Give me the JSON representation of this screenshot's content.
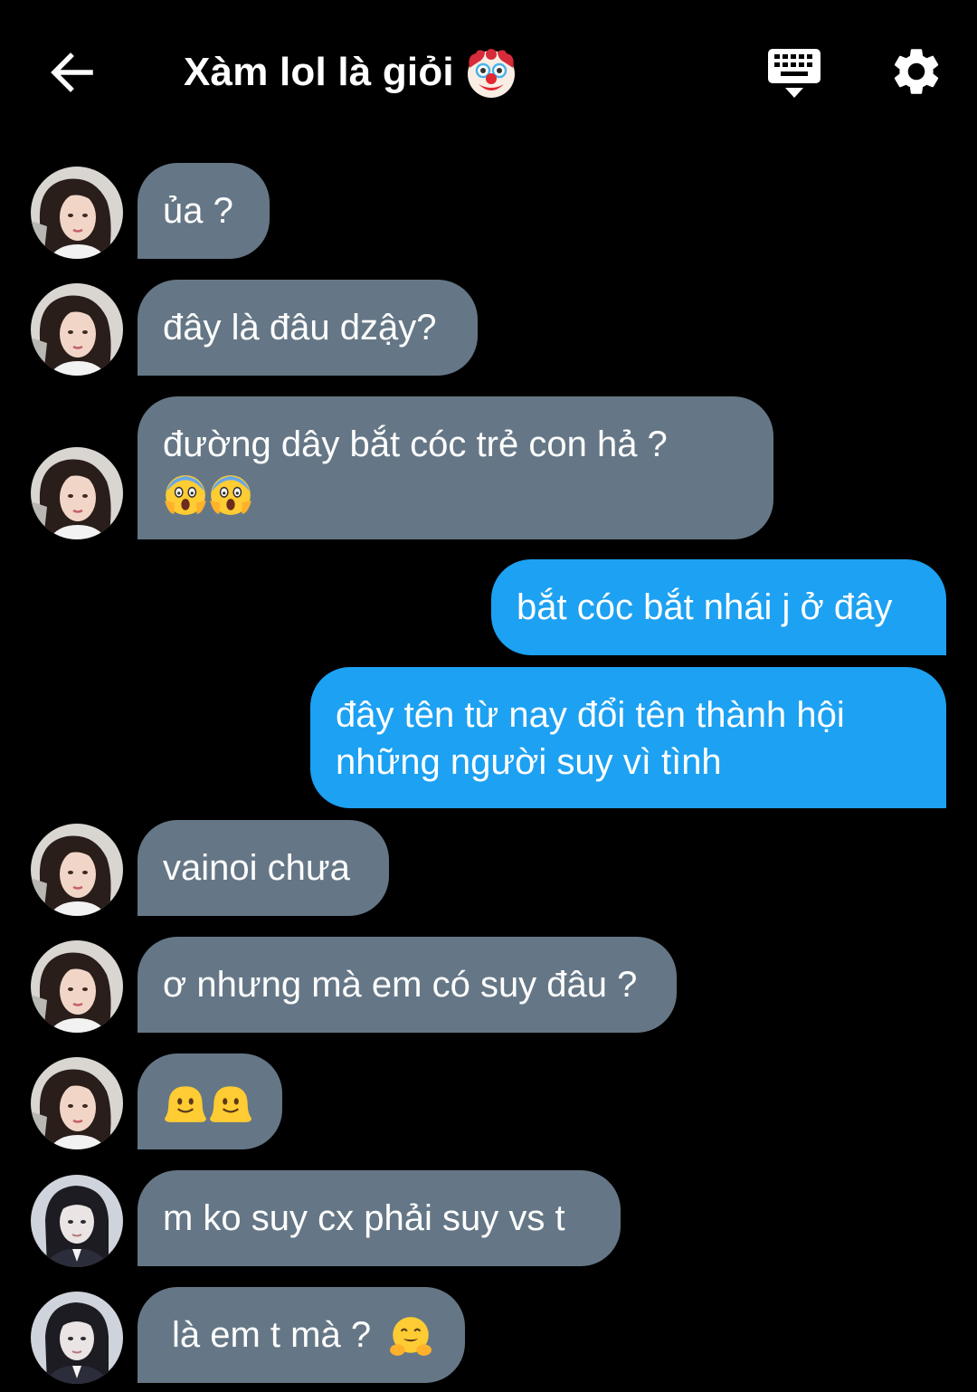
{
  "header": {
    "title": "Xàm lol là giỏi",
    "title_emoji": "clown-face-icon",
    "back_icon": "arrow-left-icon",
    "keyboard_icon": "keyboard-icon",
    "settings_icon": "gear-icon"
  },
  "colors": {
    "background": "#000000",
    "incoming_bubble": "#657786",
    "outgoing_bubble": "#1da1f2",
    "text": "#ffffff"
  },
  "messages": [
    {
      "direction": "in",
      "sender": "user-1",
      "text": "ủa ?"
    },
    {
      "direction": "in",
      "sender": "user-1",
      "text": "đây là đâu dzậy?"
    },
    {
      "direction": "in",
      "sender": "user-1",
      "text": "đường dây bắt cóc trẻ con hả ?",
      "emoji": "face-screaming-in-fear-icon x2"
    },
    {
      "direction": "out",
      "text": "bắt cóc bắt nhái j ở đây"
    },
    {
      "direction": "out",
      "text_line1": "đây tên từ nay đổi tên thành hội",
      "text_line2": "những người suy vì tình"
    },
    {
      "direction": "in",
      "sender": "user-1",
      "text": "vainoi chưa"
    },
    {
      "direction": "in",
      "sender": "user-1",
      "text": "ơ nhưng mà em có suy đâu ?"
    },
    {
      "direction": "in",
      "sender": "user-1",
      "emoji": "melting-face-icon x2"
    },
    {
      "direction": "in",
      "sender": "user-2",
      "text": "m ko suy cx phải suy vs t"
    },
    {
      "direction": "in",
      "sender": "user-2",
      "text": "là em t mà ?",
      "emoji": "hugging-face-icon"
    }
  ]
}
